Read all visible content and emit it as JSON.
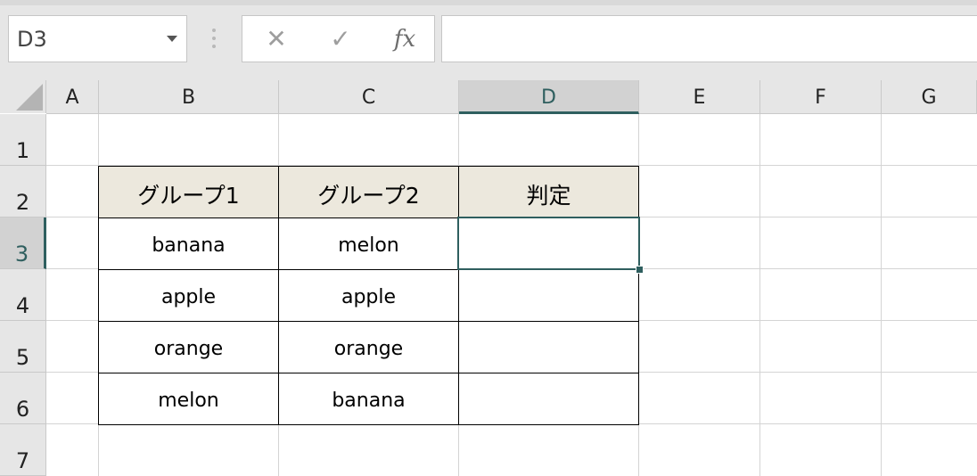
{
  "name_box": {
    "value": "D3"
  },
  "formula_bar": {
    "cancel_icon": "✕",
    "enter_icon": "✓",
    "fx_label": "fx",
    "value": ""
  },
  "columns": [
    "A",
    "B",
    "C",
    "D",
    "E",
    "F",
    "G"
  ],
  "rows": [
    "1",
    "2",
    "3",
    "4",
    "5",
    "6",
    "7"
  ],
  "active_cell": {
    "column": "D",
    "row": "3"
  },
  "table": {
    "headers": [
      "グループ1",
      "グループ2",
      "判定"
    ],
    "rows": [
      [
        "banana",
        "melon",
        ""
      ],
      [
        "apple",
        "apple",
        ""
      ],
      [
        "orange",
        "orange",
        ""
      ],
      [
        "melon",
        "banana",
        ""
      ]
    ]
  },
  "colors": {
    "header_fill": "#ece8dd",
    "selection": "#2f5f5f",
    "chrome": "#e6e6e6"
  }
}
